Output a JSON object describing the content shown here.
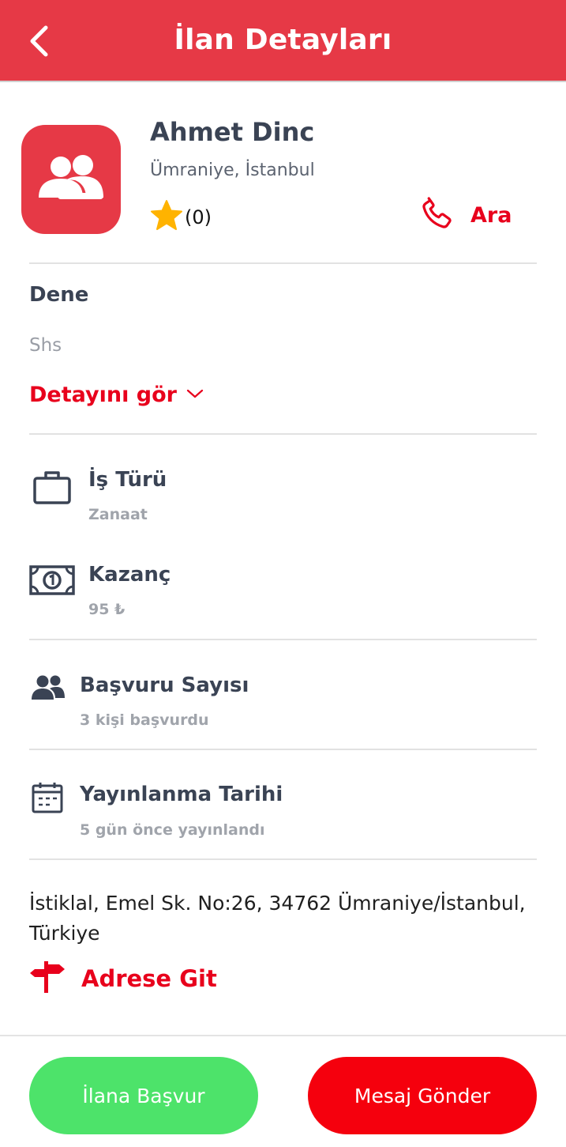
{
  "header": {
    "title": "İlan Detayları",
    "back_icon": "chevron-left-icon",
    "background_color": "#e63946"
  },
  "profile": {
    "avatar_icon": "users-icon",
    "name": "Ahmet Dinc",
    "location": "Ümraniye, İstanbul",
    "rating_icon": "star-icon",
    "rating_count": "(0)",
    "call_icon": "phone-icon",
    "call_label": "Ara"
  },
  "listing": {
    "title": "Dene",
    "description": "Shs",
    "details_link": "Detayını gör",
    "details_icon": "chevron-down-icon"
  },
  "info": [
    {
      "icon": "briefcase-icon",
      "label": "İş Türü",
      "value": "Zanaat"
    },
    {
      "icon": "banknote-icon",
      "label": "Kazanç",
      "value": "95 ₺"
    },
    {
      "icon": "users-icon",
      "label": "Başvuru Sayısı",
      "value": "3 kişi başvurdu"
    },
    {
      "icon": "calendar-icon",
      "label": "Yayınlanma Tarihi",
      "value": "5 gün önce yayınlandı"
    }
  ],
  "address": {
    "text": "İstiklal, Emel Sk. No:26, 34762 Ümraniye/İstanbul, Türkiye",
    "goto_icon": "signpost-icon",
    "goto_label": "Adrese Git"
  },
  "actions": {
    "apply_label": "İlana Başvur",
    "message_label": "Mesaj Gönder",
    "apply_color": "#4de36a",
    "message_color": "#f5000d"
  },
  "colors": {
    "accent": "#e8001c",
    "text_dark": "#3a4354",
    "text_muted": "#a0a4ab",
    "star": "#ffb300"
  }
}
